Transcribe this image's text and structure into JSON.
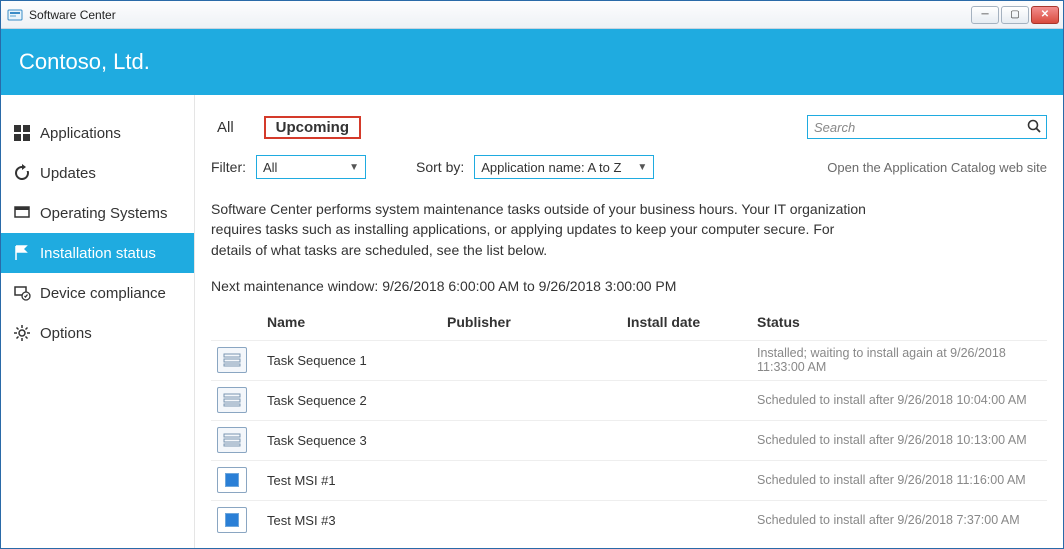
{
  "window": {
    "title": "Software Center"
  },
  "brand": {
    "org": "Contoso, Ltd."
  },
  "sidebar": {
    "items": [
      {
        "label": "Applications",
        "icon": "apps"
      },
      {
        "label": "Updates",
        "icon": "refresh"
      },
      {
        "label": "Operating Systems",
        "icon": "os"
      },
      {
        "label": "Installation status",
        "icon": "flag",
        "selected": true
      },
      {
        "label": "Device compliance",
        "icon": "shield"
      },
      {
        "label": "Options",
        "icon": "gear"
      }
    ]
  },
  "main": {
    "tabs": {
      "all": "All",
      "upcoming": "Upcoming"
    },
    "search_placeholder": "Search",
    "filter_label": "Filter:",
    "filter_value": "All",
    "sort_label": "Sort by:",
    "sort_value": "Application name: A to Z",
    "catalog_link": "Open the Application Catalog web site",
    "description": "Software Center performs system maintenance tasks outside of your business hours. Your IT organization requires tasks such as installing applications, or applying updates to keep your computer secure. For details of what tasks are scheduled, see the list below.",
    "maintenance": "Next maintenance window: 9/26/2018 6:00:00 AM to 9/26/2018 3:00:00 PM",
    "columns": {
      "name": "Name",
      "publisher": "Publisher",
      "install_date": "Install date",
      "status": "Status"
    },
    "rows": [
      {
        "type": "seq",
        "name": "Task Sequence 1",
        "publisher": "",
        "install_date": "",
        "status": "Installed; waiting to install again at 9/26/2018 11:33:00 AM"
      },
      {
        "type": "seq",
        "name": "Task Sequence 2",
        "publisher": "",
        "install_date": "",
        "status": "Scheduled to install after 9/26/2018 10:04:00 AM"
      },
      {
        "type": "seq",
        "name": "Task Sequence 3",
        "publisher": "",
        "install_date": "",
        "status": "Scheduled to install after 9/26/2018 10:13:00 AM"
      },
      {
        "type": "msi",
        "name": "Test MSI #1",
        "publisher": "",
        "install_date": "",
        "status": "Scheduled to install after 9/26/2018 11:16:00 AM"
      },
      {
        "type": "msi",
        "name": "Test MSI #3",
        "publisher": "",
        "install_date": "",
        "status": "Scheduled to install after 9/26/2018 7:37:00 AM"
      }
    ]
  }
}
